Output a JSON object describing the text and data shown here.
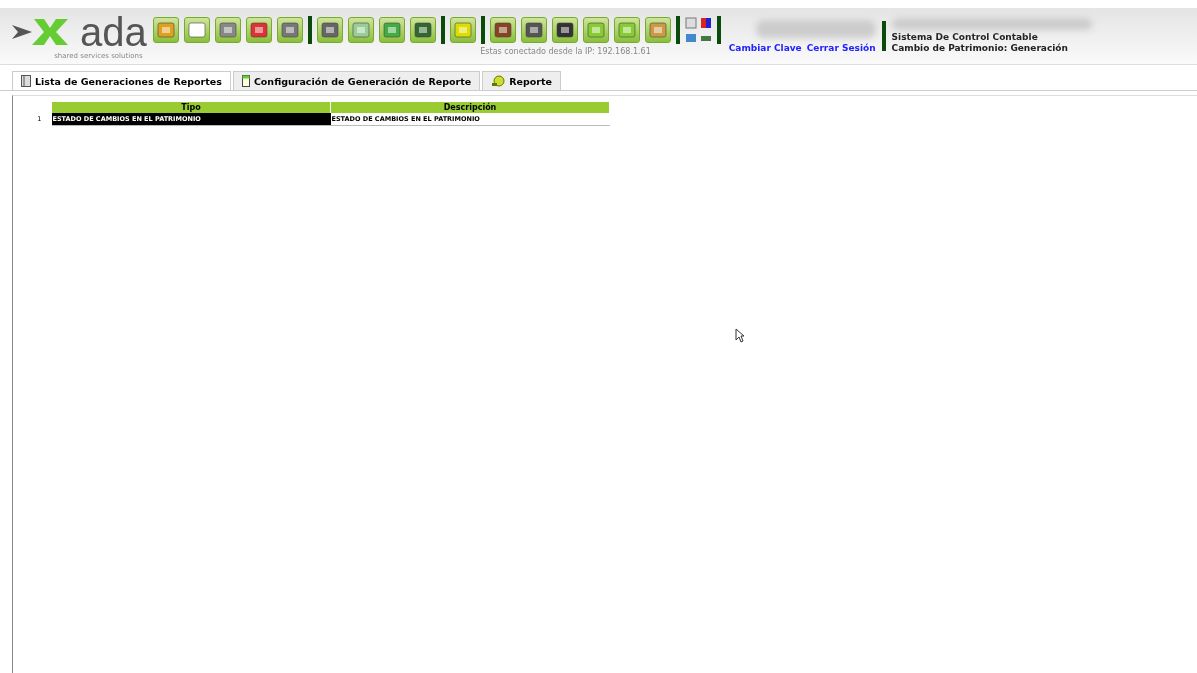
{
  "header": {
    "logo": "ada",
    "tagline": "shared services solutions",
    "connection": "Estas conectado desde la IP: 192.168.1.61",
    "links": [
      "Cambiar Clave",
      "Cerrar Sesión"
    ],
    "system": [
      "Sistema De Control Contable",
      "Cambio de Patrimonio: Generación"
    ]
  },
  "tabs": [
    {
      "label": "Lista de Generaciones de Reportes",
      "selected": true
    },
    {
      "label": "Configuración de Generación de Reporte",
      "selected": false
    },
    {
      "label": "Reporte",
      "selected": false
    }
  ],
  "table": {
    "columns": [
      "Tipo",
      "Descripción"
    ],
    "rows": [
      {
        "number": "1",
        "cells": [
          "ESTADO DE CAMBIOS EN EL PATRIMONIO",
          "ESTADO DE CAMBIOS EN EL PATRIMONIO"
        ],
        "selected": true
      }
    ]
  }
}
